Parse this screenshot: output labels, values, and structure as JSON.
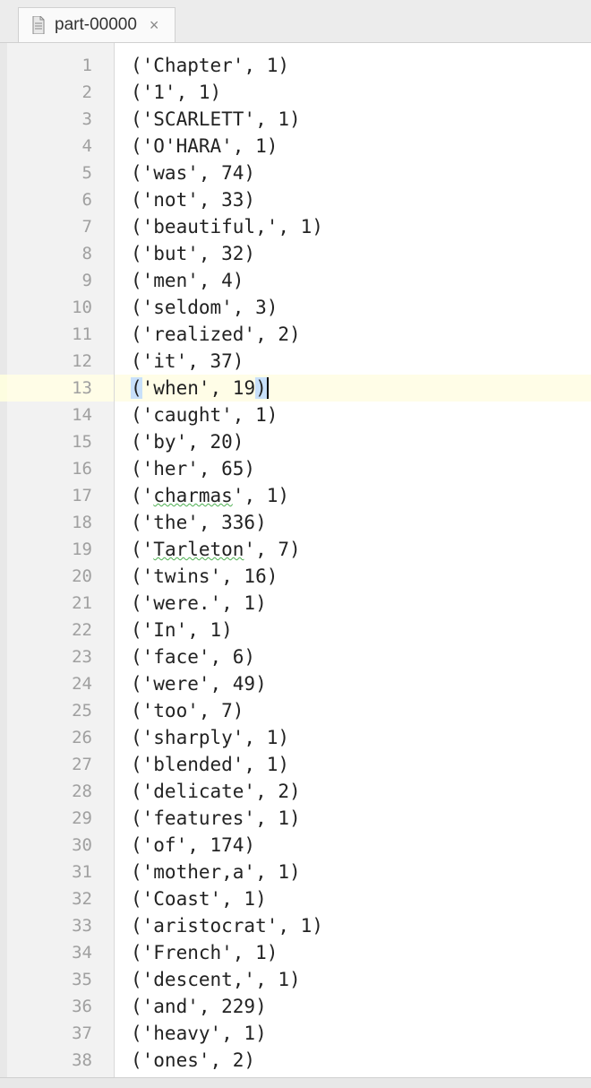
{
  "tab": {
    "filename": "part-00000"
  },
  "editor": {
    "active_line": 13,
    "spellcheck_lines": [
      17,
      19
    ],
    "lines": [
      {
        "n": 1,
        "word": "Chapter",
        "count": 1
      },
      {
        "n": 2,
        "word": "1",
        "count": 1
      },
      {
        "n": 3,
        "word": "SCARLETT",
        "count": 1
      },
      {
        "n": 4,
        "word": "O'HARA",
        "count": 1
      },
      {
        "n": 5,
        "word": "was",
        "count": 74
      },
      {
        "n": 6,
        "word": "not",
        "count": 33
      },
      {
        "n": 7,
        "word": "beautiful,",
        "count": 1
      },
      {
        "n": 8,
        "word": "but",
        "count": 32
      },
      {
        "n": 9,
        "word": "men",
        "count": 4
      },
      {
        "n": 10,
        "word": "seldom",
        "count": 3
      },
      {
        "n": 11,
        "word": "realized",
        "count": 2
      },
      {
        "n": 12,
        "word": "it",
        "count": 37
      },
      {
        "n": 13,
        "word": "when",
        "count": 19
      },
      {
        "n": 14,
        "word": "caught",
        "count": 1
      },
      {
        "n": 15,
        "word": "by",
        "count": 20
      },
      {
        "n": 16,
        "word": "her",
        "count": 65
      },
      {
        "n": 17,
        "word": "charmas",
        "count": 1
      },
      {
        "n": 18,
        "word": "the",
        "count": 336
      },
      {
        "n": 19,
        "word": "Tarleton",
        "count": 7
      },
      {
        "n": 20,
        "word": "twins",
        "count": 16
      },
      {
        "n": 21,
        "word": "were.",
        "count": 1
      },
      {
        "n": 22,
        "word": "In",
        "count": 1
      },
      {
        "n": 23,
        "word": "face",
        "count": 6
      },
      {
        "n": 24,
        "word": "were",
        "count": 49
      },
      {
        "n": 25,
        "word": "too",
        "count": 7
      },
      {
        "n": 26,
        "word": "sharply",
        "count": 1
      },
      {
        "n": 27,
        "word": "blended",
        "count": 1
      },
      {
        "n": 28,
        "word": "delicate",
        "count": 2
      },
      {
        "n": 29,
        "word": "features",
        "count": 1
      },
      {
        "n": 30,
        "word": "of",
        "count": 174
      },
      {
        "n": 31,
        "word": "mother,a",
        "count": 1
      },
      {
        "n": 32,
        "word": "Coast",
        "count": 1
      },
      {
        "n": 33,
        "word": "aristocrat",
        "count": 1
      },
      {
        "n": 34,
        "word": "French",
        "count": 1
      },
      {
        "n": 35,
        "word": "descent,",
        "count": 1
      },
      {
        "n": 36,
        "word": "and",
        "count": 229
      },
      {
        "n": 37,
        "word": "heavy",
        "count": 1
      },
      {
        "n": 38,
        "word": "ones",
        "count": 2
      }
    ]
  }
}
